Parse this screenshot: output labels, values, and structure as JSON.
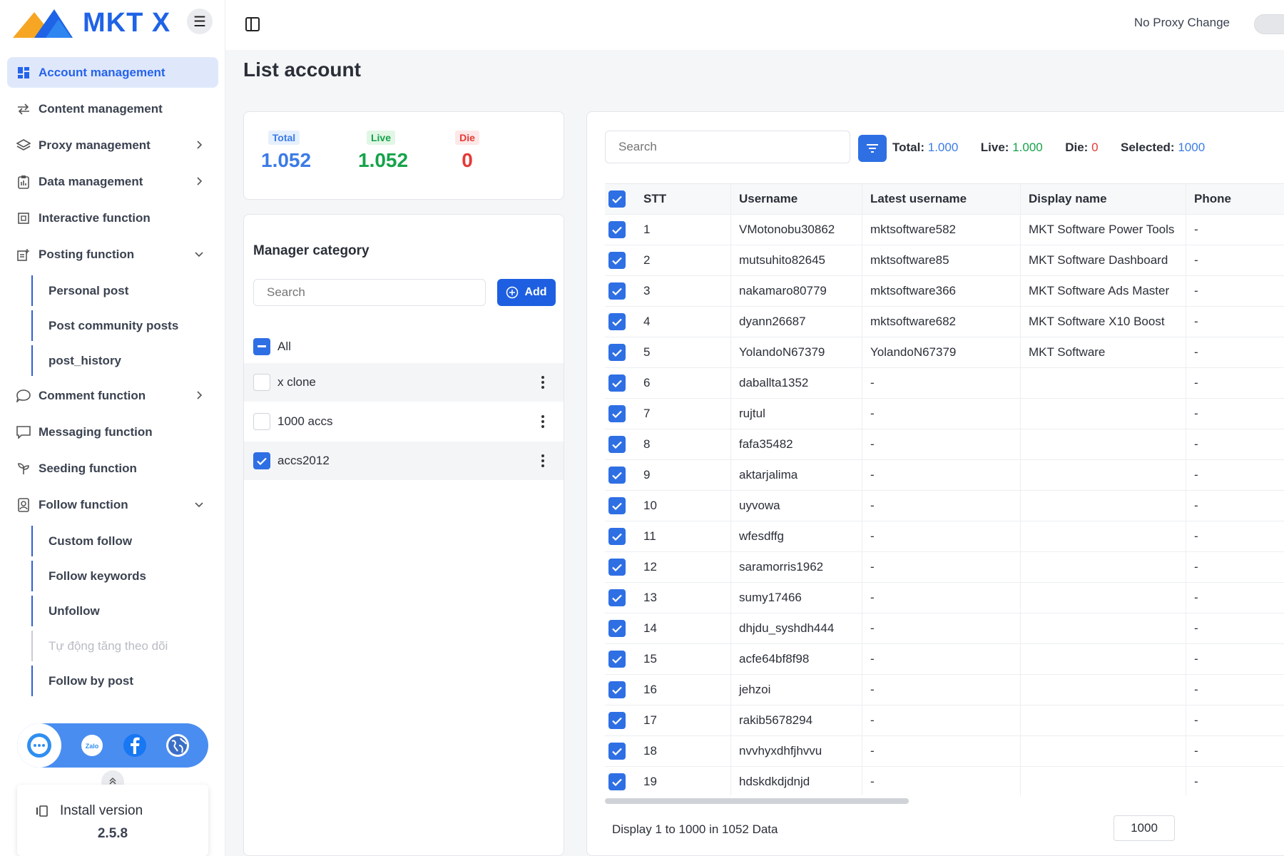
{
  "app": {
    "logo_text": "MKT X"
  },
  "sidebar": {
    "items": [
      {
        "label": "Account management",
        "icon": "grid-icon",
        "active": true
      },
      {
        "label": "Content management",
        "icon": "swap-icon"
      },
      {
        "label": "Proxy management",
        "icon": "layers-icon",
        "chevron": "right"
      },
      {
        "label": "Data management",
        "icon": "clipboard-icon",
        "chevron": "right"
      },
      {
        "label": "Interactive function",
        "icon": "box-icon"
      },
      {
        "label": "Posting function",
        "icon": "post-icon",
        "chevron": "down"
      }
    ],
    "posting_sub": [
      "Personal post",
      "Post community posts",
      "post_history"
    ],
    "items2": [
      {
        "label": "Comment function",
        "icon": "comment-icon",
        "chevron": "right"
      },
      {
        "label": "Messaging function",
        "icon": "message-icon"
      },
      {
        "label": "Seeding function",
        "icon": "sprout-icon"
      },
      {
        "label": "Follow function",
        "icon": "follow-icon",
        "chevron": "down"
      }
    ],
    "follow_sub": [
      "Custom follow",
      "Follow keywords",
      "Unfollow",
      "Tự động tăng theo dõi",
      "Follow by post"
    ],
    "install_label": "Install version",
    "install_version": "2.5.8"
  },
  "topbar": {
    "proxy_label": "No Proxy Change"
  },
  "page": {
    "title": "List account"
  },
  "stats": {
    "total_label": "Total",
    "total_value": "1.052",
    "live_label": "Live",
    "live_value": "1.052",
    "die_label": "Die",
    "die_value": "0"
  },
  "category": {
    "title": "Manager category",
    "search_placeholder": "Search",
    "add_label": "Add",
    "all_label": "All",
    "items": [
      {
        "name": "x clone",
        "checked": false
      },
      {
        "name": "1000 accs",
        "checked": false
      },
      {
        "name": "accs2012",
        "checked": true
      }
    ]
  },
  "table": {
    "search_placeholder": "Search",
    "summary": {
      "total_label": "Total:",
      "total_value": "1.000",
      "live_label": "Live:",
      "live_value": "1.000",
      "die_label": "Die:",
      "die_value": "0",
      "selected_label": "Selected:",
      "selected_value": "1000"
    },
    "columns": [
      "STT",
      "Username",
      "Latest username",
      "Display name",
      "Phone"
    ],
    "rows": [
      [
        "1",
        "VMotonobu30862",
        "mktsoftware582",
        "MKT Software Power Tools",
        "-"
      ],
      [
        "2",
        "mutsuhito82645",
        "mktsoftware85",
        "MKT Software Dashboard",
        "-"
      ],
      [
        "3",
        "nakamaro80779",
        "mktsoftware366",
        "MKT Software Ads Master",
        "-"
      ],
      [
        "4",
        "dyann26687",
        "mktsoftware682",
        "MKT Software X10 Boost",
        "-"
      ],
      [
        "5",
        "YolandoN67379",
        "YolandoN67379",
        "MKT Software",
        "-"
      ],
      [
        "6",
        "daballta1352",
        "-",
        "",
        "-"
      ],
      [
        "7",
        "rujtul",
        "-",
        "",
        "-"
      ],
      [
        "8",
        "fafa35482",
        "-",
        "",
        "-"
      ],
      [
        "9",
        "aktarjalima",
        "-",
        "",
        "-"
      ],
      [
        "10",
        "uyvowa",
        "-",
        "",
        "-"
      ],
      [
        "11",
        "wfesdffg",
        "-",
        "",
        "-"
      ],
      [
        "12",
        "saramorris1962",
        "-",
        "",
        "-"
      ],
      [
        "13",
        "sumy17466",
        "-",
        "",
        "-"
      ],
      [
        "14",
        "dhjdu_syshdh444",
        "-",
        "",
        "-"
      ],
      [
        "15",
        "acfe64bf8f98",
        "-",
        "",
        "-"
      ],
      [
        "16",
        "jehzoi",
        "-",
        "",
        "-"
      ],
      [
        "17",
        "rakib5678294",
        "-",
        "",
        "-"
      ],
      [
        "18",
        "nvvhyxdhfjhvvu",
        "-",
        "",
        "-"
      ],
      [
        "19",
        "hdskdkdjdnjd",
        "-",
        "",
        "-"
      ]
    ],
    "footer": "Display 1 to 1000 in 1052 Data",
    "page_size": "1000"
  },
  "colors": {
    "primary": "#2f6fe4",
    "accent_blue": "#1d5fe0",
    "live_green": "#16a34a",
    "die_red": "#e53935"
  }
}
